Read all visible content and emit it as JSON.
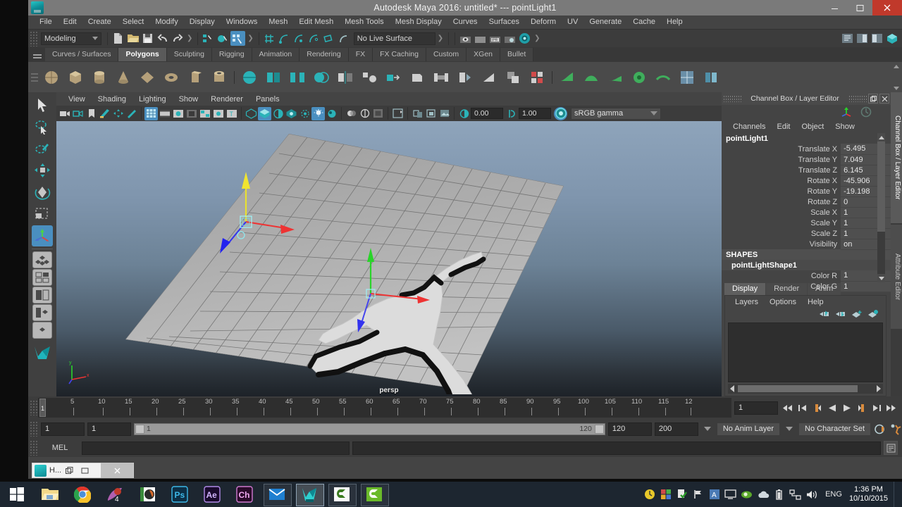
{
  "window": {
    "title": "Autodesk Maya 2016: untitled*   ---   pointLight1",
    "app_icon": "maya-icon",
    "minimize": "minimize-icon",
    "maximize": "maximize-icon",
    "close": "close-icon"
  },
  "menubar": {
    "items": [
      "File",
      "Edit",
      "Create",
      "Select",
      "Modify",
      "Display",
      "Windows",
      "Mesh",
      "Edit Mesh",
      "Mesh Tools",
      "Mesh Display",
      "Curves",
      "Surfaces",
      "Deform",
      "UV",
      "Generate",
      "Cache",
      "Help"
    ]
  },
  "statusline": {
    "menuset": "Modeling",
    "live_surface": "No Live Surface",
    "icons": [
      "new-scene-icon",
      "open-scene-icon",
      "save-scene-icon",
      "undo-icon",
      "redo-icon",
      "select-by-hierarchy-icon",
      "select-by-object-icon",
      "select-by-component-icon",
      "snap-to-grid-icon",
      "snap-to-curve-icon",
      "snap-to-point-icon",
      "snap-to-projected-center-icon",
      "snap-to-view-plane-icon",
      "make-live-icon",
      "render-current-frame-icon",
      "ipr-render-icon",
      "render-settings-icon",
      "hypershade-icon"
    ]
  },
  "shelf": {
    "tabs": [
      "Curves / Surfaces",
      "Polygons",
      "Sculpting",
      "Rigging",
      "Animation",
      "Rendering",
      "FX",
      "FX Caching",
      "Custom",
      "XGen",
      "Bullet"
    ],
    "active_tab": "Polygons",
    "icon_count": 30
  },
  "toolbox": {
    "tools": [
      "select-tool",
      "lasso-select-tool",
      "paint-select-tool",
      "move-tool",
      "rotate-tool",
      "scale-tool",
      "last-tool-used",
      "layout-single-perspective",
      "layout-four-view",
      "layout-two-pane-side",
      "layout-two-pane-stacked",
      "layout-persp-outliner",
      "layout-hypergraph",
      "maya-logo"
    ],
    "active_tool": "last-tool-used"
  },
  "viewport": {
    "menus": [
      "View",
      "Shading",
      "Lighting",
      "Show",
      "Renderer",
      "Panels"
    ],
    "camera_label": "persp",
    "toolbar": {
      "exposure": "0.00",
      "gamma": "1.00",
      "color_management": "sRGB gamma",
      "icons": [
        "select-camera-icon",
        "lock-camera-icon",
        "bookmark-icon",
        "image-plane-icon",
        "two-d-pan-zoom-icon",
        "grease-pencil-icon",
        "grid-toggle-icon",
        "film-gate-icon",
        "resolution-gate-icon",
        "gate-mask-icon",
        "film-origin-icon",
        "safe-action-icon",
        "safe-title-icon",
        "wireframe-icon",
        "smooth-shade-all-icon",
        "shaded-wireframe-icon",
        "textured-icon",
        "use-all-lights-icon",
        "shadows-icon",
        "screen-space-ao-icon",
        "motion-blur-icon",
        "multisample-icon",
        "isolate-select-icon",
        "xray-icon",
        "xray-joints-icon",
        "xray-active-components-icon",
        "exposure-icon",
        "gamma-icon",
        "color-management-toggle-icon"
      ]
    },
    "gizmo": {
      "type": "move-manipulator",
      "axes": [
        "x-axis-red",
        "y-axis-yellow",
        "z-axis-blue"
      ]
    },
    "axis_indicator": [
      "y-axis-green",
      "x-axis-red",
      "z-axis-blue"
    ]
  },
  "channel_box": {
    "panel_title": "Channel Box / Layer Editor",
    "toolbar_icons": [
      "channel-box-icon",
      "layer-editor-icon"
    ],
    "menus": [
      "Channels",
      "Edit",
      "Object",
      "Show"
    ],
    "node_name": "pointLight1",
    "attributes": [
      {
        "label": "Translate X",
        "value": "-5.495"
      },
      {
        "label": "Translate Y",
        "value": "7.049"
      },
      {
        "label": "Translate Z",
        "value": "6.145"
      },
      {
        "label": "Rotate X",
        "value": "-45.906"
      },
      {
        "label": "Rotate Y",
        "value": "-19.198"
      },
      {
        "label": "Rotate Z",
        "value": "0"
      },
      {
        "label": "Scale X",
        "value": "1"
      },
      {
        "label": "Scale Y",
        "value": "1"
      },
      {
        "label": "Scale Z",
        "value": "1"
      },
      {
        "label": "Visibility",
        "value": "on"
      }
    ],
    "shapes_header": "SHAPES",
    "shape_name": "pointLightShape1",
    "shape_attributes": [
      {
        "label": "Color R",
        "value": "1"
      },
      {
        "label": "Color G",
        "value": "1"
      }
    ]
  },
  "layer_editor": {
    "tabs": [
      "Display",
      "Render",
      "Anim"
    ],
    "active_tab": "Display",
    "menus": [
      "Layers",
      "Options",
      "Help"
    ],
    "buttons": [
      "move-layer-up-icon",
      "move-layer-down-icon",
      "new-layer-icon",
      "new-layer-from-selected-icon"
    ],
    "layers": []
  },
  "dock_tabs": {
    "items": [
      "Channel Box / Layer Editor",
      "Attribute Editor"
    ],
    "active": "Channel Box / Layer Editor"
  },
  "time_slider": {
    "ticks": [
      "5",
      "10",
      "15",
      "20",
      "25",
      "30",
      "35",
      "40",
      "45",
      "50",
      "55",
      "60",
      "65",
      "70",
      "75",
      "80",
      "85",
      "90",
      "95",
      "100",
      "105",
      "110",
      "115",
      "12"
    ],
    "current_frame_marker": "1",
    "current_frame_field": "1",
    "playback_buttons": [
      "go-to-start-icon",
      "step-back-frame-icon",
      "step-back-key-icon",
      "play-backwards-icon",
      "play-forwards-icon",
      "step-forward-key-icon",
      "step-forward-frame-icon",
      "go-to-end-icon"
    ]
  },
  "range_slider": {
    "anim_start": "1",
    "playback_start": "1",
    "range_low_label": "1",
    "range_high_label": "120",
    "playback_end": "120",
    "anim_end": "200",
    "anim_layer": "No Anim Layer",
    "character_set": "No Character Set",
    "right_icons": [
      "auto-keyframe-icon",
      "animation-preferences-icon"
    ]
  },
  "command_line": {
    "label": "MEL",
    "input_value": "",
    "output_value": "",
    "script_editor_icon": "script-editor-icon"
  },
  "mini_window": {
    "title": "H...",
    "buttons": [
      "restore-icon",
      "maximize-icon",
      "close-icon"
    ]
  },
  "taskbar": {
    "start": "windows-start-icon",
    "items": [
      "file-explorer-icon",
      "google-chrome-icon",
      "nero-icon",
      "cyberlink-icon",
      "photoshop-icon",
      "after-effects-icon",
      "character-animator-icon",
      "mail-icon",
      "maya-icon",
      "camtasia-editor-icon",
      "camtasia-recorder-icon"
    ],
    "active_item": "maya-icon",
    "tray_icons": [
      "safely-remove-hardware-icon",
      "antivirus-icon",
      "checkmark-icon",
      "flag-action-center-icon",
      "adobe-updater-icon",
      "display-icon",
      "nvidia-icon",
      "onedrive-icon",
      "battery-icon",
      "network-icon",
      "volume-icon"
    ],
    "language": "ENG",
    "time": "1:36 PM",
    "date": "10/10/2015"
  },
  "colors": {
    "accent_blue": "#4a8fc0",
    "teal": "#2bb3b8",
    "panel_bg": "#444444",
    "dark_field": "#2b2b2b",
    "close_red": "#c0392b",
    "taskbar_bg": "#1d2630"
  }
}
